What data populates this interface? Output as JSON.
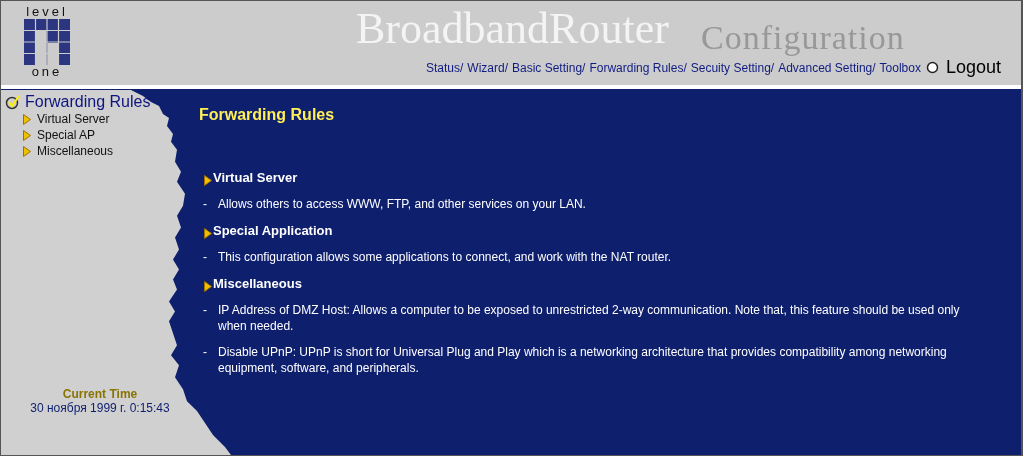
{
  "logo": {
    "top": "level",
    "bottom": "one"
  },
  "header": {
    "title": "BroadbandRouter",
    "subtitle": "Configuration"
  },
  "nav": [
    {
      "label": "Status/"
    },
    {
      "label": "Wizard/"
    },
    {
      "label": "Basic Setting/"
    },
    {
      "label": "Forwarding Rules/"
    },
    {
      "label": "Secuity Setting/"
    },
    {
      "label": "Advanced Setting/"
    },
    {
      "label": "Toolbox"
    }
  ],
  "logout": "Logout",
  "sidebar": {
    "title": "Forwarding Rules",
    "items": [
      {
        "label": "Virtual Server"
      },
      {
        "label": "Special AP"
      },
      {
        "label": "Miscellaneous"
      }
    ],
    "time_label": "Current Time",
    "time": "30 ноября 1999 г. 0:15:43"
  },
  "main": {
    "title": "Forwarding Rules",
    "sections": [
      {
        "heading": "Virtual Server",
        "notes": [
          {
            "bullet": "-",
            "text": "Allows others to access WWW, FTP, and other services on your LAN."
          }
        ]
      },
      {
        "heading": "Special Application",
        "notes": [
          {
            "bullet": "-",
            "text": "This configuration allows some applications to connect, and work with the NAT router."
          }
        ]
      },
      {
        "heading": "Miscellaneous",
        "notes": [
          {
            "bullet": "-",
            "text": "IP Address of DMZ Host: Allows a computer to be exposed to unrestricted 2-way communication. Note that, this feature should be used only when needed."
          },
          {
            "bullet": "-",
            "text": "Disable UPnP: UPnP is short for Universal Plug and Play which is a networking architecture that provides compatibility among networking equipment, software, and peripherals."
          }
        ]
      }
    ]
  }
}
